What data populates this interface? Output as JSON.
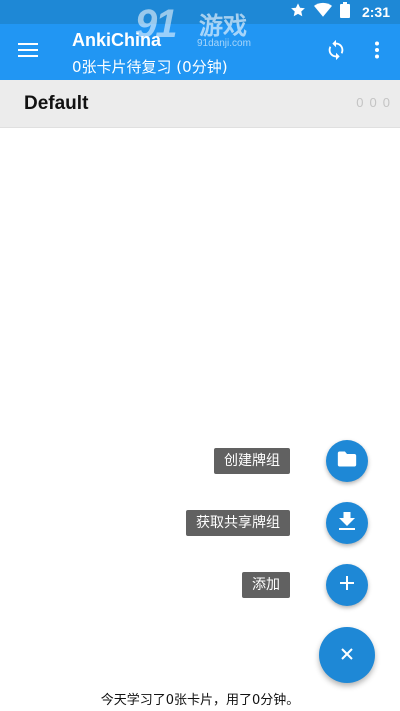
{
  "status_bar": {
    "time": "2:31",
    "icons": [
      "star-icon",
      "wifi-icon",
      "battery-icon"
    ]
  },
  "watermark": {
    "number": "91",
    "text": "游戏",
    "url": "91danji.com"
  },
  "toolbar": {
    "title": "AnkiChina",
    "subtitle": "0张卡片待复习 (0分钟)",
    "icons": [
      "menu-icon",
      "sync-icon",
      "more-vert-icon"
    ]
  },
  "decks": [
    {
      "name": "Default",
      "new": "0",
      "learning": "0",
      "review": "0"
    }
  ],
  "fab_menu": {
    "create_deck": "创建牌组",
    "shared_decks": "获取共享牌组",
    "add": "添加",
    "close_icon": "close-icon"
  },
  "footer": {
    "stats": "今天学习了0张卡片，用了0分钟。"
  },
  "colors": {
    "primary": "#2196f3",
    "status_bar": "#1e88d6",
    "fab": "#1e88d6",
    "label_bg": "#616161",
    "deck_row_bg": "#ececec"
  }
}
